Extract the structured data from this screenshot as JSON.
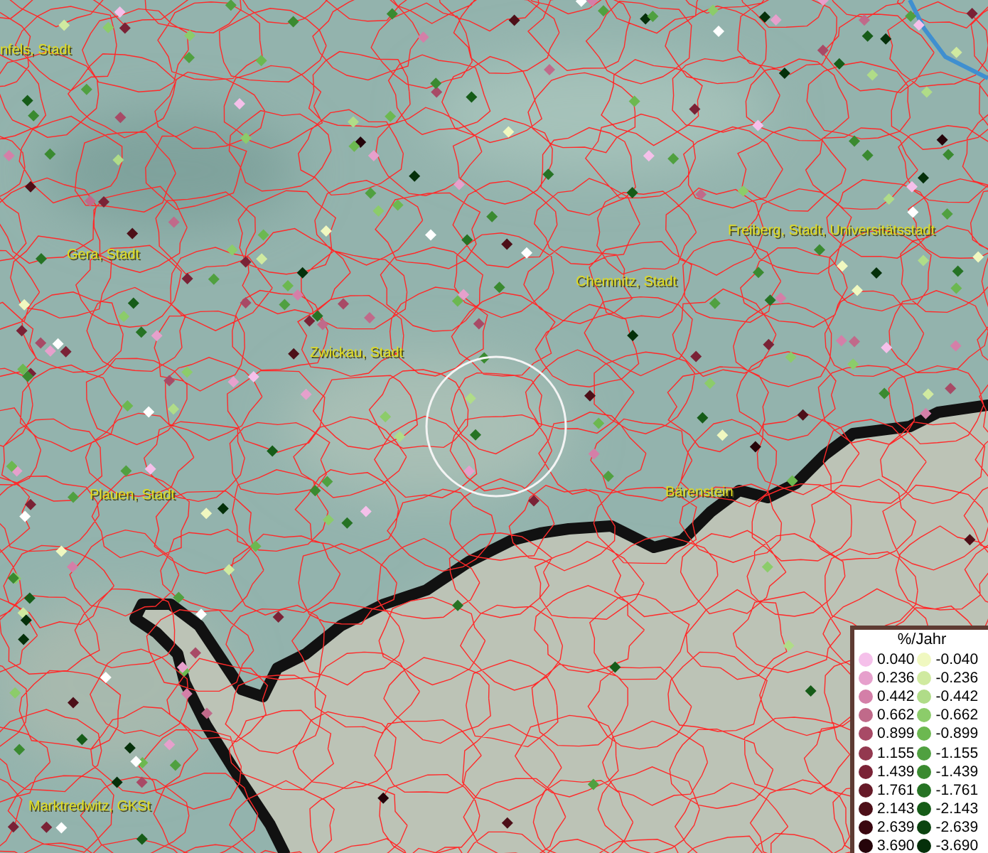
{
  "map": {
    "place_labels": [
      {
        "text": "nfels, Stadt"
      },
      {
        "text": "Gera, Stadt"
      },
      {
        "text": "Zwickau, Stadt"
      },
      {
        "text": "Chemnitz, Stadt"
      },
      {
        "text": "Freiberg, Stadt, Universitätsstadt"
      },
      {
        "text": "Plauen, Stadt"
      },
      {
        "text": "Bärenstein"
      },
      {
        "text": "Marktredwitz, GKSt"
      }
    ]
  },
  "legend": {
    "title": "%/Jahr",
    "columns": [
      {
        "items": [
          {
            "label": "0.040",
            "color": "#f5c0ea"
          },
          {
            "label": "0.236",
            "color": "#e6a0cc"
          },
          {
            "label": "0.442",
            "color": "#d47fa8"
          },
          {
            "label": "0.662",
            "color": "#c06a8a"
          },
          {
            "label": "0.899",
            "color": "#a84a66"
          },
          {
            "label": "1.155",
            "color": "#93384f"
          },
          {
            "label": "1.439",
            "color": "#7a2236"
          },
          {
            "label": "1.761",
            "color": "#661a28"
          },
          {
            "label": "2.143",
            "color": "#4d0f18"
          },
          {
            "label": "2.639",
            "color": "#3a0710"
          },
          {
            "label": "3.690",
            "color": "#25040a"
          }
        ]
      },
      {
        "items": [
          {
            "label": "-0.040",
            "color": "#f0f8c0"
          },
          {
            "label": "-0.236",
            "color": "#d0eaa0"
          },
          {
            "label": "-0.442",
            "color": "#b0dc88"
          },
          {
            "label": "-0.662",
            "color": "#8ccc6a"
          },
          {
            "label": "-0.899",
            "color": "#6cb850"
          },
          {
            "label": "-1.155",
            "color": "#50a040"
          },
          {
            "label": "-1.439",
            "color": "#3a8a30"
          },
          {
            "label": "-1.761",
            "color": "#267324"
          },
          {
            "label": "-2.143",
            "color": "#165c18"
          },
          {
            "label": "-2.639",
            "color": "#0c4410"
          },
          {
            "label": "-3.690",
            "color": "#05300a"
          }
        ]
      }
    ]
  }
}
